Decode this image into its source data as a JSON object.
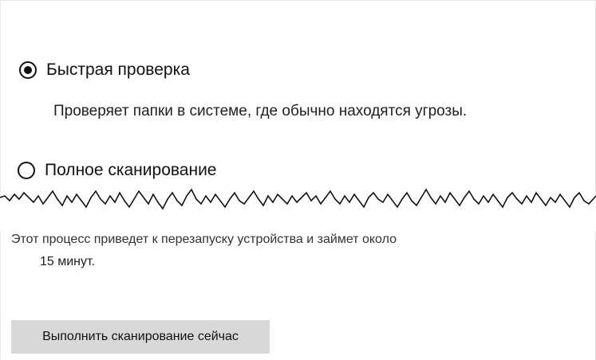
{
  "scan_options": {
    "quick": {
      "label": "Быстрая проверка",
      "description": "Проверяет папки в системе, где обычно находятся угрозы.",
      "selected": true
    },
    "full": {
      "label": "Полное сканирование",
      "description_partial": "Этот процесс приведет к перезапуску устройства и займет около",
      "description_end": "15 минут.",
      "selected": false
    }
  },
  "actions": {
    "scan_now_label": "Выполнить сканирование сейчас"
  }
}
